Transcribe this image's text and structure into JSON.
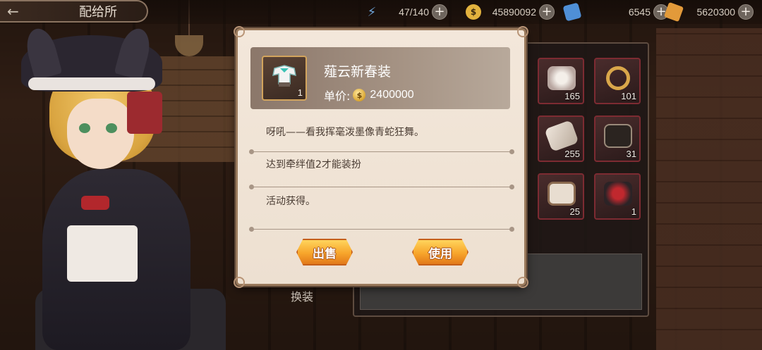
{
  "header": {
    "title": "配给所"
  },
  "resources": [
    {
      "name": "stamina",
      "icon": "lightning-icon",
      "value": "47/140",
      "color": "#6ea4d8"
    },
    {
      "name": "gold",
      "icon": "gold-coin-icon",
      "value": "45890092",
      "color": "#e2b23e"
    },
    {
      "name": "ticket",
      "icon": "blue-ticket-icon",
      "value": "6545",
      "color": "#4f8fd6"
    },
    {
      "name": "crystal",
      "icon": "amber-crystal-icon",
      "value": "5620300",
      "color": "#e29a3a"
    }
  ],
  "inventory": {
    "slots": [
      {
        "icon": "ring-box-icon",
        "count": "165"
      },
      {
        "icon": "gem-ring-icon",
        "count": "101"
      },
      {
        "icon": "scroll-icon",
        "count": "255"
      },
      {
        "icon": "ornate-box-icon",
        "count": "31"
      },
      {
        "icon": "photo-frame-icon",
        "count": "25"
      },
      {
        "icon": "outfit-icon",
        "count": "1"
      }
    ],
    "change_outfit_label": "换装"
  },
  "modal": {
    "item_name": "薤云新春装",
    "item_count": "1",
    "price_label": "单价:",
    "price_value": "2400000",
    "description": "呀吼——看我挥毫泼墨像青蛇狂舞。",
    "requirement": "达到牵绊值2才能装扮",
    "source": "活动获得。",
    "sell_label": "出售",
    "use_label": "使用"
  },
  "colors": {
    "modal_bg": "#f3e7da",
    "button_gold": "#f7a52b",
    "slot_border": "#7d2b32"
  }
}
